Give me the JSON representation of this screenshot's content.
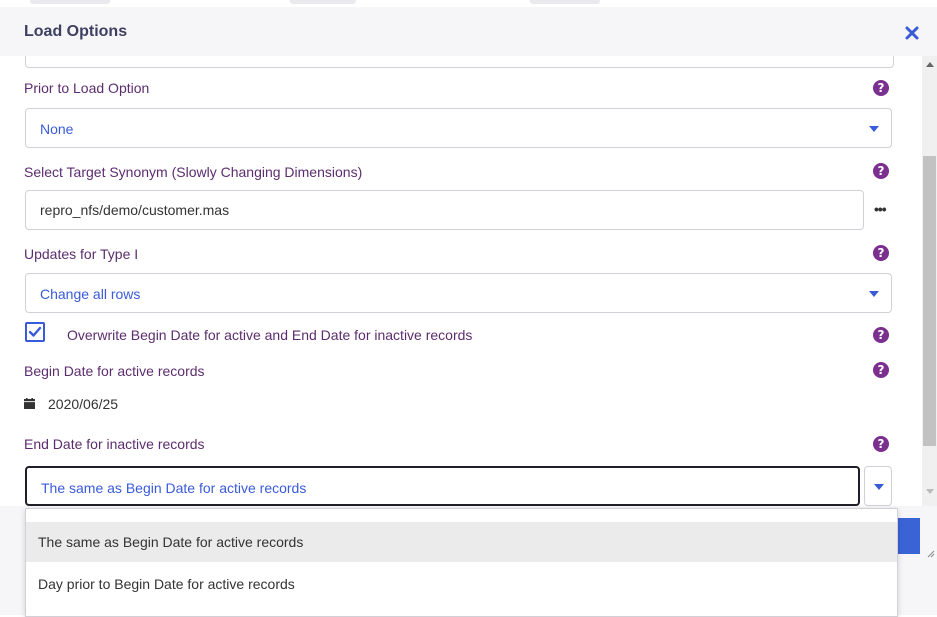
{
  "dialog": {
    "title": "Load Options"
  },
  "fields": {
    "prior_load": {
      "label": "Prior to Load Option",
      "value": "None"
    },
    "target_synonym": {
      "label": "Select Target Synonym (Slowly Changing Dimensions)",
      "value": "repro_nfs/demo/customer.mas",
      "browse_label": "•••"
    },
    "type1_updates": {
      "label": "Updates for Type I",
      "value": "Change all rows"
    },
    "overwrite": {
      "label": "Overwrite Begin Date for active and End Date for inactive records",
      "checked": true
    },
    "begin_date": {
      "label": "Begin Date for active records",
      "value": "2020/06/25"
    },
    "end_date": {
      "label": "End Date for inactive records",
      "value": "The same as Begin Date for active records"
    }
  },
  "dropdown": {
    "options": [
      "The same as Begin Date for active records",
      "Day prior to Begin Date for active records"
    ],
    "highlighted_index": 0
  },
  "colors": {
    "accent": "#3a5bd9",
    "help": "#7b2f8f",
    "label": "#5c2d6e",
    "title": "#3d4060"
  },
  "icons": {
    "close": "close-icon",
    "help": "question-circle-icon",
    "calendar": "calendar-icon",
    "caret": "caret-down-icon"
  }
}
